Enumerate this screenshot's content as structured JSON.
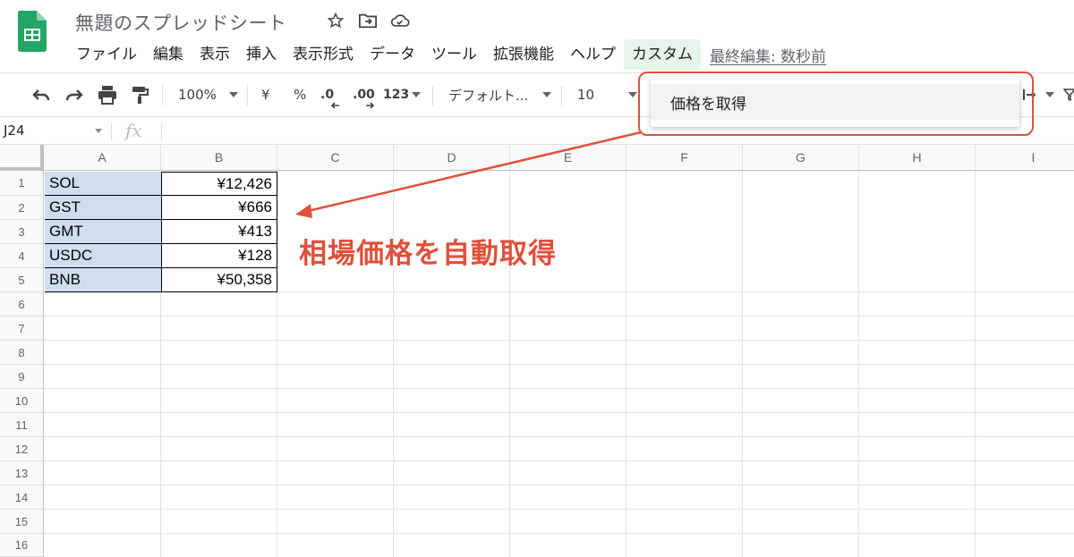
{
  "app": {
    "doc_title": "無題のスプレッドシート"
  },
  "menu": {
    "items": [
      "ファイル",
      "編集",
      "表示",
      "挿入",
      "表示形式",
      "データ",
      "ツール",
      "拡張機能",
      "ヘルプ",
      "カスタム"
    ],
    "last_edit": "最終編集: 数秒前"
  },
  "toolbar": {
    "zoom": "100%",
    "currency": "¥",
    "percent": "%",
    "decimal_decrease": ".0",
    "decimal_increase": ".00",
    "number_format": "123",
    "font": "デフォルト...",
    "font_size": "10"
  },
  "formula_bar": {
    "cell_ref": "J24",
    "fx": "fx"
  },
  "columns": [
    "A",
    "B",
    "C",
    "D",
    "E",
    "F",
    "G",
    "H",
    "I"
  ],
  "rows": [
    "1",
    "2",
    "3",
    "4",
    "5",
    "6",
    "7",
    "8",
    "9",
    "10",
    "11",
    "12",
    "13",
    "14",
    "15",
    "16"
  ],
  "cells": [
    {
      "a": "SOL",
      "b": "¥12,426"
    },
    {
      "a": "GST",
      "b": "¥666"
    },
    {
      "a": "GMT",
      "b": "¥413"
    },
    {
      "a": "USDC",
      "b": "¥128"
    },
    {
      "a": "BNB",
      "b": "¥50,358"
    }
  ],
  "custom_menu": {
    "item": "価格を取得"
  },
  "annotation": {
    "text": "相場価格を自動取得"
  },
  "colors": {
    "accent_red": "#e0503a",
    "selected_fill": "#d0dff0",
    "sheets_green": "#0f9d58"
  }
}
